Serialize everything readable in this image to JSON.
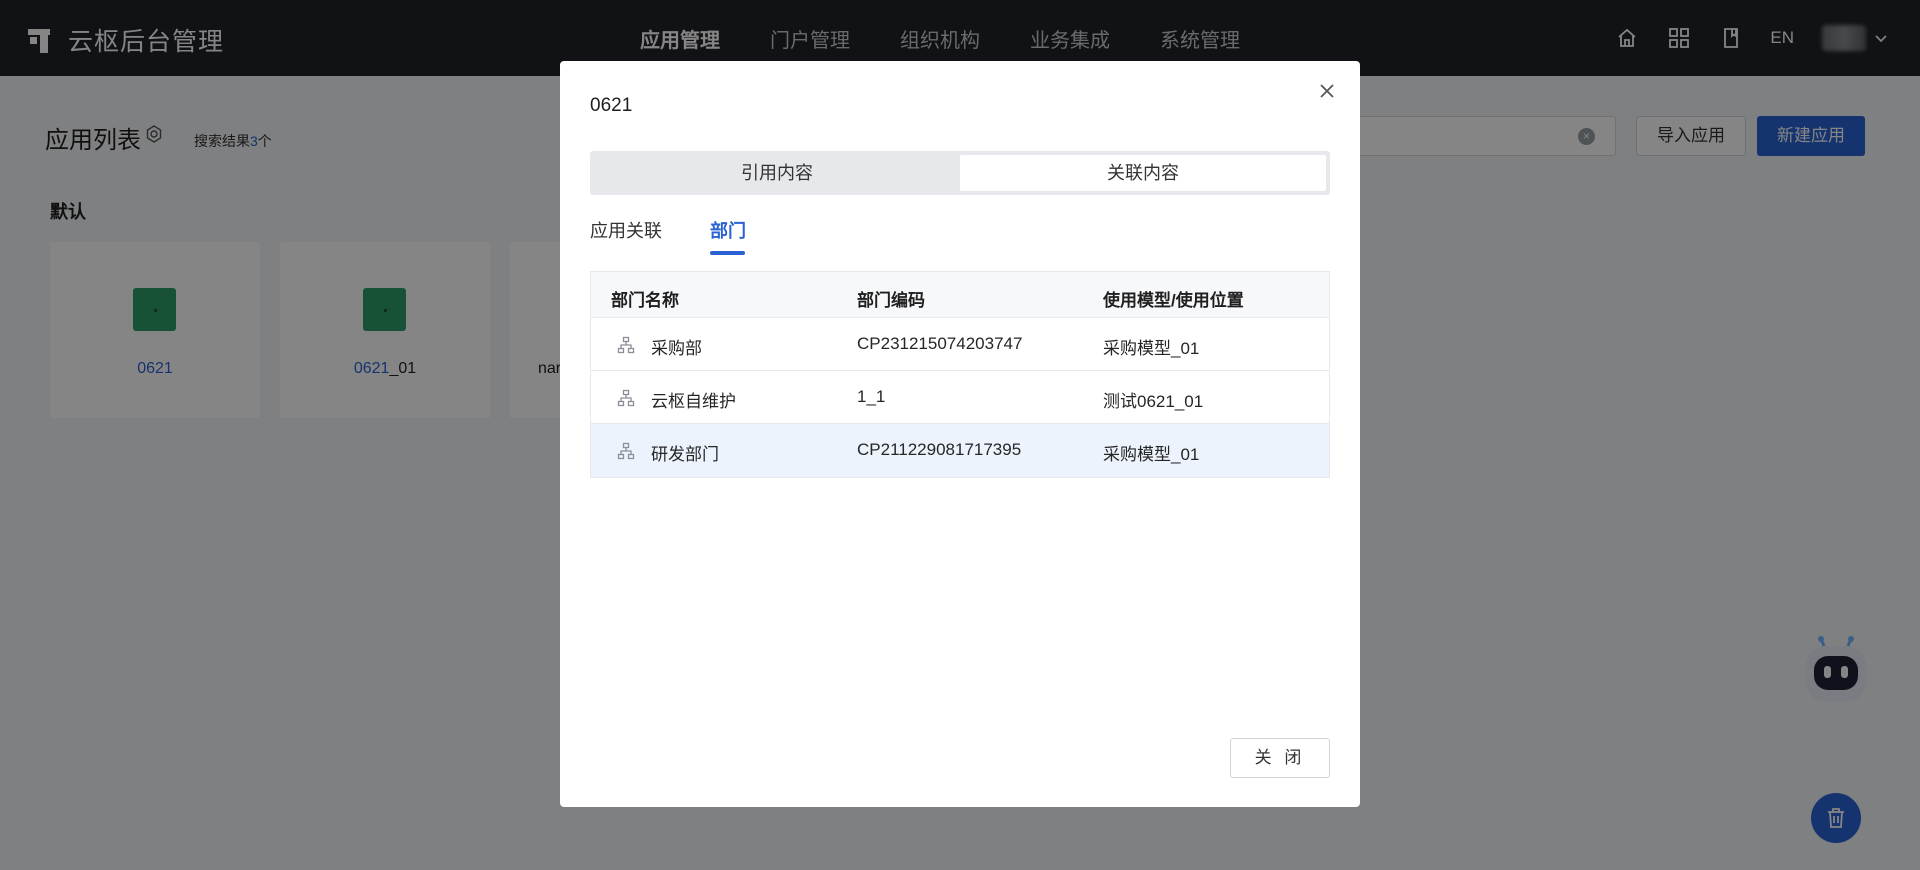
{
  "app": {
    "title": "云枢后台管理"
  },
  "nav": {
    "items": [
      {
        "label": "应用管理",
        "active": true
      },
      {
        "label": "门户管理"
      },
      {
        "label": "组织机构"
      },
      {
        "label": "业务集成"
      },
      {
        "label": "系统管理"
      }
    ],
    "lang": "EN",
    "icons": [
      "home-icon",
      "apps-grid-icon",
      "book-icon",
      "chevron-down-icon"
    ]
  },
  "page": {
    "title": "应用列表",
    "search_result_prefix": "搜索结果",
    "search_result_count": "3",
    "search_result_suffix": "个",
    "import_label": "导入应用",
    "new_label": "新建应用",
    "group_label": "默认",
    "cards": [
      {
        "name_highlight": "0621",
        "name_rest": ""
      },
      {
        "name_highlight": "0621",
        "name_rest": "_01"
      },
      {
        "name_highlight": "",
        "name_rest": "nar"
      }
    ]
  },
  "modal": {
    "title": "0621",
    "segments": [
      "引用内容",
      "关联内容"
    ],
    "active_segment": "关联内容",
    "subtabs": [
      "应用关联",
      "部门"
    ],
    "active_subtab": "部门",
    "columns": [
      "部门名称",
      "部门编码",
      "使用模型/使用位置"
    ],
    "rows": [
      {
        "name": "采购部",
        "code": "CP231215074203747",
        "location": "采购模型_01"
      },
      {
        "name": "云枢自维护",
        "code": "1_1",
        "location": "测试0621_01"
      },
      {
        "name": "研发部门",
        "code": "CP211229081717395",
        "location": "采购模型_01",
        "highlighted": true
      }
    ],
    "close_label": "关 闭"
  },
  "colors": {
    "topbar": "#1f2329",
    "primary": "#2a62d4",
    "card_icon": "#2e9e68",
    "page_bg": "#f4f5f7"
  }
}
